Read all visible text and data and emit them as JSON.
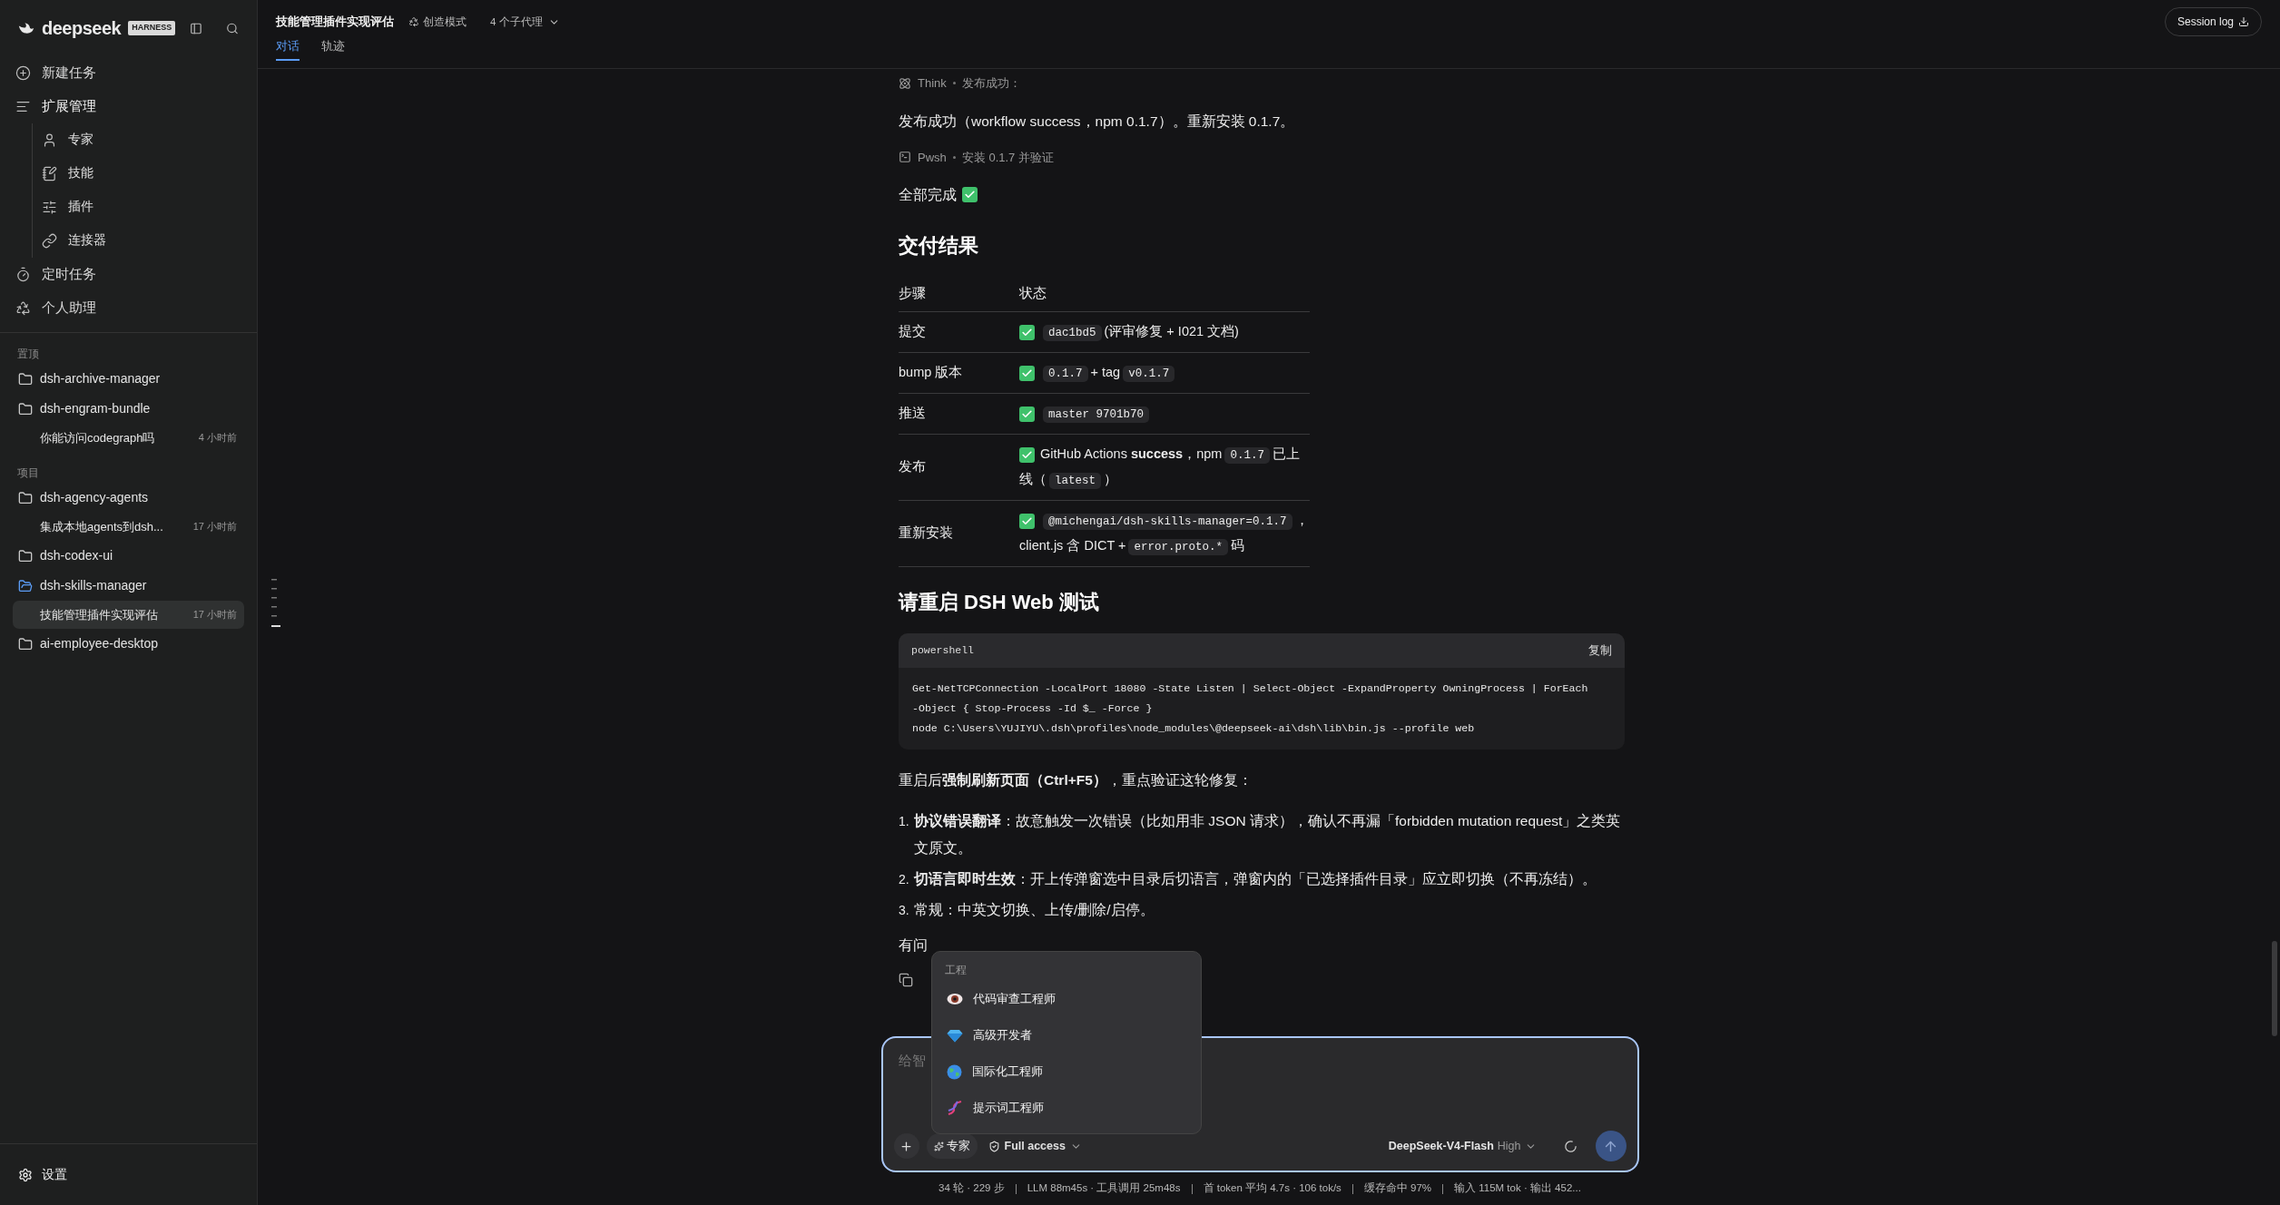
{
  "sidebar": {
    "brand": "deepseek",
    "badge": "HARNESS",
    "nav": [
      {
        "label": "新建任务",
        "expanded": false
      },
      {
        "label": "扩展管理",
        "expanded": true,
        "children": [
          {
            "label": "专家"
          },
          {
            "label": "技能"
          },
          {
            "label": "插件"
          },
          {
            "label": "连接器"
          }
        ]
      },
      {
        "label": "定时任务",
        "expanded": false
      },
      {
        "label": "个人助理",
        "expanded": false
      }
    ],
    "sections": [
      {
        "title": "置顶",
        "projects": [
          {
            "name": "dsh-archive-manager",
            "current": false
          },
          {
            "name": "dsh-engram-bundle",
            "current": false,
            "sessions": [
              {
                "title": "你能访问codegraph吗",
                "time": "4 小时前",
                "selected": false
              }
            ]
          }
        ]
      },
      {
        "title": "项目",
        "projects": [
          {
            "name": "dsh-agency-agents",
            "current": false,
            "sessions": [
              {
                "title": "集成本地agents到dsh...",
                "time": "17 小时前",
                "selected": false
              }
            ]
          },
          {
            "name": "dsh-codex-ui",
            "current": false
          },
          {
            "name": "dsh-skills-manager",
            "current": true,
            "sessions": [
              {
                "title": "技能管理插件实现评估",
                "time": "17 小时前",
                "selected": true
              }
            ]
          },
          {
            "name": "ai-employee-desktop",
            "current": false
          }
        ]
      }
    ],
    "settings": "设置"
  },
  "header": {
    "title": "技能管理插件实现评估",
    "mode": "创造模式",
    "agents": "4 个子代理",
    "session_log": "Session log",
    "tabs": [
      {
        "label": "对话",
        "selected": true
      },
      {
        "label": "轨迹",
        "selected": false
      }
    ]
  },
  "blocks": [
    {
      "kind": "think",
      "label": "Think",
      "detail": "发布成功："
    },
    {
      "kind": "paragraph",
      "text": "发布成功（workflow success，npm 0.1.7）。重新安装 0.1.7。"
    },
    {
      "kind": "shell",
      "label": "Pwsh",
      "detail": "安装 0.1.7 并验证"
    },
    {
      "kind": "done",
      "text": "全部完成"
    },
    {
      "kind": "heading",
      "text": "交付结果"
    },
    {
      "kind": "table",
      "columns": [
        "步骤",
        "状态"
      ],
      "rows": [
        {
          "step": "提交",
          "parts": [
            {
              "kind": "check"
            },
            {
              "kind": "code",
              "text": "dac1bd5"
            },
            {
              "kind": "text",
              "text": "(评审修复 + I021 文档)"
            }
          ]
        },
        {
          "step": "bump 版本",
          "parts": [
            {
              "kind": "check"
            },
            {
              "kind": "code",
              "text": "0.1.7"
            },
            {
              "kind": "text",
              "text": "+ tag"
            },
            {
              "kind": "code",
              "text": "v0.1.7"
            }
          ]
        },
        {
          "step": "推送",
          "parts": [
            {
              "kind": "check"
            },
            {
              "kind": "code",
              "text": "master 9701b70"
            }
          ]
        },
        {
          "step": "发布",
          "parts": [
            {
              "kind": "check"
            },
            {
              "kind": "text",
              "text": "GitHub Actions **success**，npm"
            },
            {
              "kind": "code",
              "text": "0.1.7"
            },
            {
              "kind": "text",
              "text": "已上"
            },
            {
              "kind": "text",
              "text": "线（"
            },
            {
              "kind": "code",
              "text": "latest"
            },
            {
              "kind": "text",
              "text": "）"
            }
          ]
        },
        {
          "step": "重新安装",
          "parts": [
            {
              "kind": "check"
            },
            {
              "kind": "code",
              "text": "@michengai/dsh-skills-manager=0.1.7"
            },
            {
              "kind": "text",
              "text": "，"
            },
            {
              "kind": "text",
              "text": "client.js 含 DICT +"
            },
            {
              "kind": "code",
              "text": "error.proto.*"
            },
            {
              "kind": "text",
              "text": "码"
            }
          ]
        }
      ]
    },
    {
      "kind": "heading",
      "text": "请重启 DSH Web 测试"
    },
    {
      "kind": "code",
      "language": "powershell",
      "copy": "复制",
      "lines": [
        "Get-NetTCPConnection -LocalPort 18080 -State Listen | Select-Object -ExpandProperty OwningProcess | ForEach",
        "-Object { Stop-Process -Id $_ -Force }",
        "node C:\\Users\\YUJIYU\\.dsh\\profiles\\node_modules\\@deepseek-ai\\dsh\\lib\\bin.js --profile web"
      ]
    },
    {
      "kind": "paragraph",
      "text": "重启后**强制刷新页面（Ctrl+F5）**，重点验证这轮修复："
    },
    {
      "kind": "list",
      "items": [
        {
          "number": "1.",
          "text": "**协议错误翻译**：故意触发一次错误（比如用非 JSON 请求），确认不再漏「forbidden mutation request」之类英文原文。"
        },
        {
          "number": "2.",
          "text": "**切语言即时生效**：开上传弹窗选中目录后切语言，弹窗内的「已选择插件目录」应立即切换（不再冻结）。"
        },
        {
          "number": "3.",
          "text": "常规：中英文切换、上传/删除/启停。"
        }
      ]
    },
    {
      "kind": "paragraph",
      "text": "有问"
    },
    {
      "kind": "copy"
    }
  ],
  "popup": {
    "group": "工程",
    "items": [
      {
        "label": "代码审查工程师"
      },
      {
        "label": "高级开发者"
      },
      {
        "label": "国际化工程师"
      },
      {
        "label": "提示词工程师"
      }
    ]
  },
  "composer": {
    "placeholder": "给智",
    "expert": "专家",
    "access": "Full access",
    "model": "DeepSeek-V4-Flash",
    "effort": "High",
    "send_disabled": true
  },
  "status_bar": [
    "34 轮 · 229 步",
    "LLM 88m45s · 工具调用 25m48s",
    "首 token 平均 4.7s · 106 tok/s",
    "缓存命中 97%",
    "输入 115M tok · 输出 452..."
  ]
}
